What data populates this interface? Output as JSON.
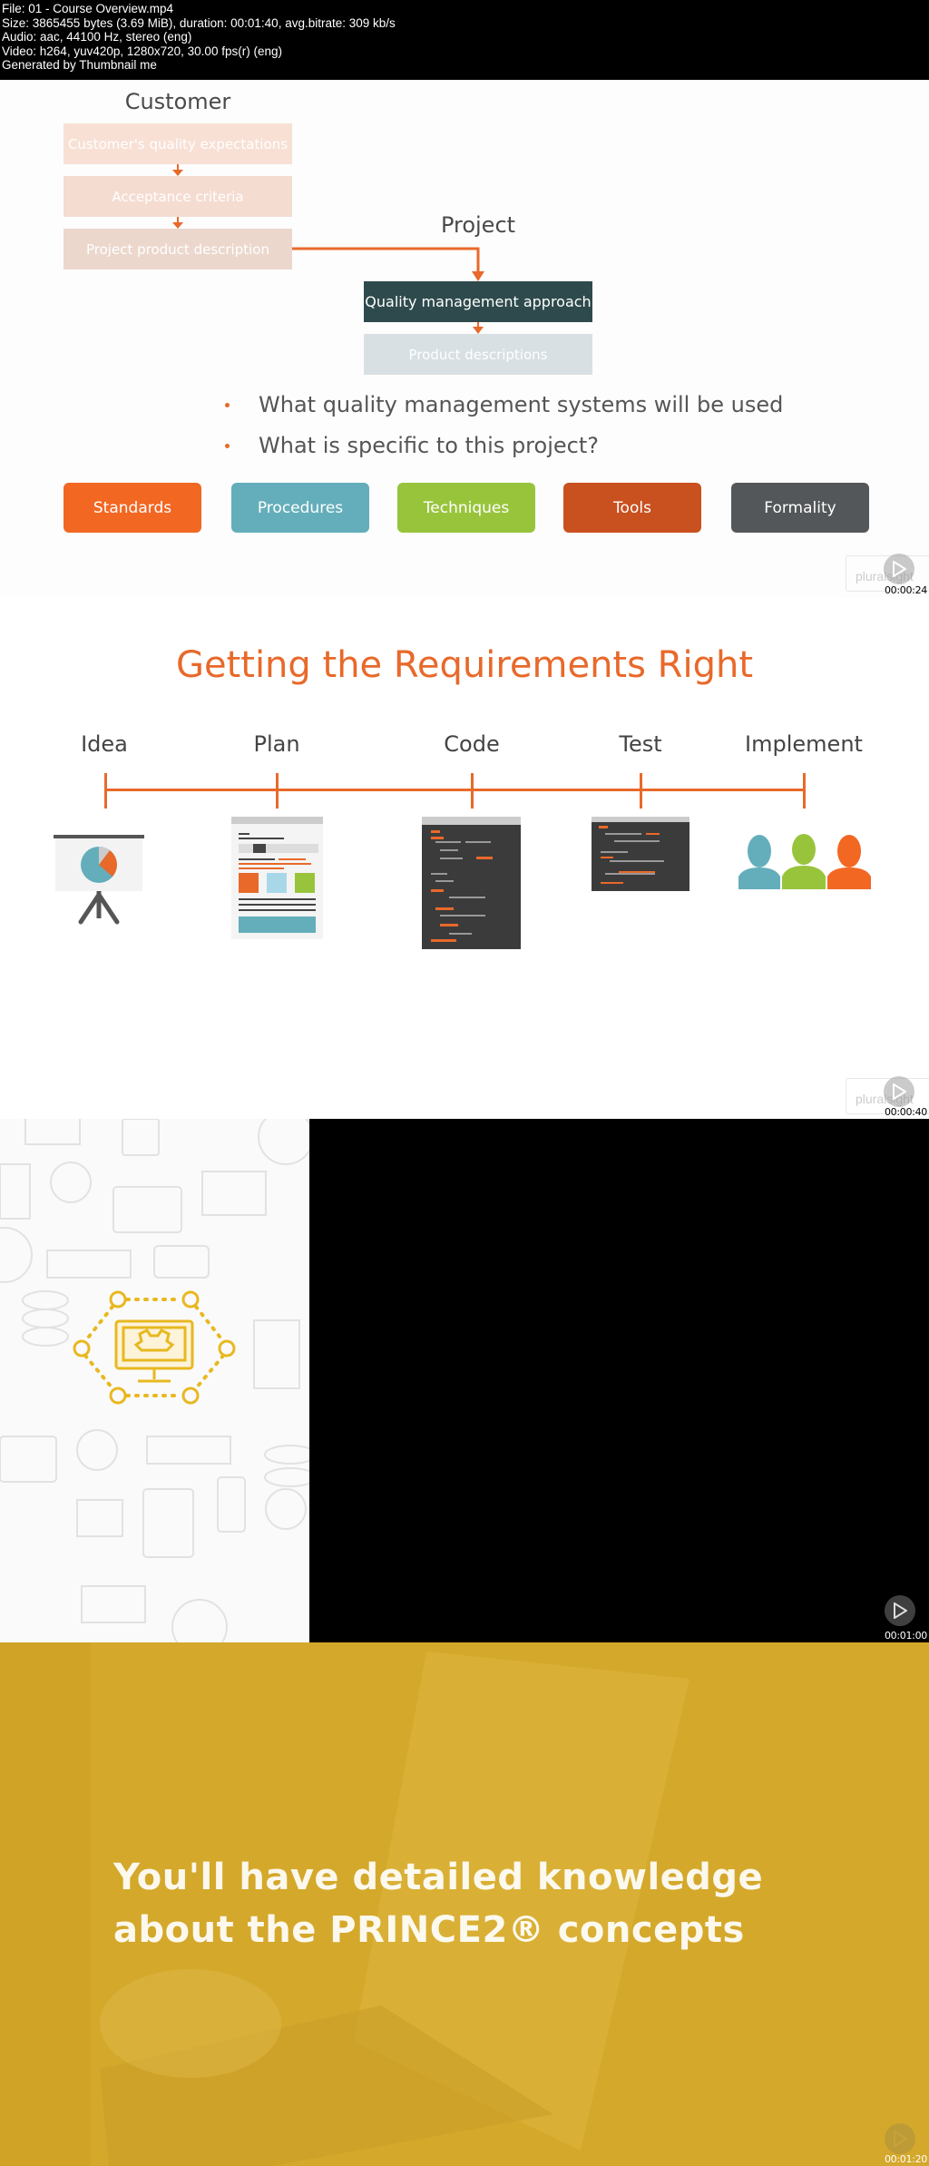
{
  "header": {
    "lines": [
      "File: 01 - Course Overview.mp4",
      "Size: 3865455 bytes (3.69 MiB), duration: 00:01:40, avg.bitrate: 309 kb/s",
      "Audio: aac, 44100 Hz, stereo (eng)",
      "Video: h264, yuv420p, 1280x720, 30.00 fps(r) (eng)",
      "Generated by Thumbnail me"
    ]
  },
  "frames": [
    {
      "timestamp": "00:00:24",
      "logo": "pluralsight",
      "customer_title": "Customer",
      "customer_boxes": [
        "Customer's quality expectations",
        "Acceptance criteria",
        "Project product description"
      ],
      "project_title": "Project",
      "project_boxes": [
        "Quality management approach",
        "Product descriptions"
      ],
      "bullets": [
        "What quality management systems will be used",
        "What is specific to this project?"
      ],
      "tags": [
        {
          "label": "Standards",
          "color": "#f26722"
        },
        {
          "label": "Procedures",
          "color": "#64aebb"
        },
        {
          "label": "Techniques",
          "color": "#98c43c"
        },
        {
          "label": "Tools",
          "color": "#c9501f"
        },
        {
          "label": "Formality",
          "color": "#535759"
        }
      ]
    },
    {
      "timestamp": "00:00:40",
      "logo": "pluralsight",
      "title": "Getting the Requirements Right",
      "stages": [
        "Idea",
        "Plan",
        "Code",
        "Test",
        "Implement"
      ],
      "accent": "#e8692a"
    },
    {
      "timestamp": "00:01:00",
      "icon": "monitor-gear-network-icon"
    },
    {
      "timestamp": "00:01:20",
      "lines": [
        "You'll have detailed knowledge",
        "about the PRINCE2® concepts"
      ],
      "background": "#d4a82a"
    }
  ]
}
